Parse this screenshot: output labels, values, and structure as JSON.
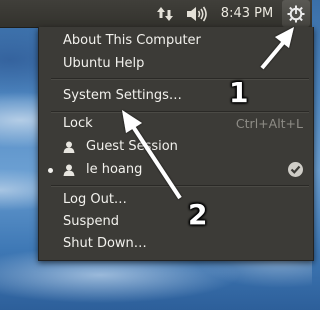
{
  "panel": {
    "clock": "8:43 PM"
  },
  "menu": {
    "items": [
      {
        "label": "About This Computer"
      },
      {
        "label": "Ubuntu Help"
      },
      {
        "label": "System Settings…"
      },
      {
        "label": "Lock",
        "shortcut": "Ctrl+Alt+L"
      },
      {
        "label": "Guest Session"
      },
      {
        "label": "le hoang"
      },
      {
        "label": "Log Out…"
      },
      {
        "label": "Suspend"
      },
      {
        "label": "Shut Down…"
      }
    ]
  },
  "annotations": {
    "one": "1",
    "two": "2"
  },
  "icons": {
    "network": "network-updown-icon",
    "sound": "speaker-volume-icon",
    "session": "gear-power-icon",
    "user": "user-icon",
    "check": "checkmark-icon"
  }
}
